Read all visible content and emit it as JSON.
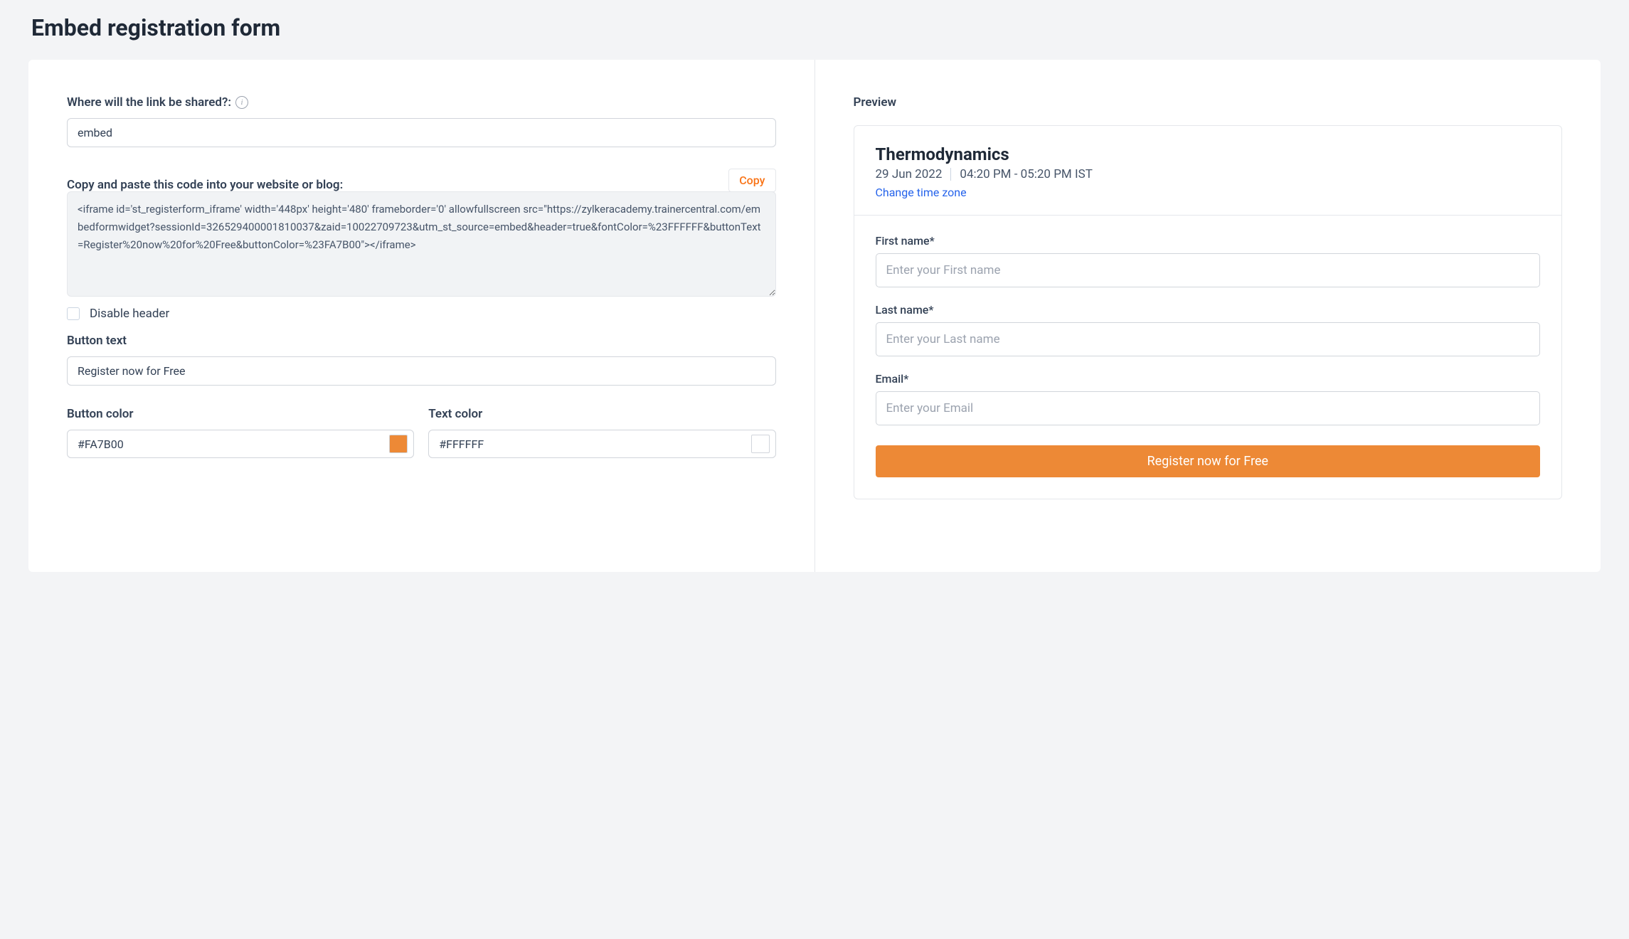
{
  "page_title": "Embed registration form",
  "left": {
    "share_label": "Where will the link be shared?:",
    "share_value": "embed",
    "code_label": "Copy and paste this code into your website or blog:",
    "copy_label": "Copy",
    "code_value": "<iframe id='st_registerform_iframe' width='448px' height='480' frameborder='0' allowfullscreen src=\"https://zylkeracademy.trainercentral.com/embedformwidget?sessionId=326529400001810037&zaid=10022709723&utm_st_source=embed&header=true&fontColor=%23FFFFFF&buttonText=Register%20now%20for%20Free&buttonColor=%23FA7B00\"></iframe>",
    "disable_header_label": "Disable header",
    "button_text_label": "Button text",
    "button_text_value": "Register now for Free",
    "button_color_label": "Button color",
    "button_color_value": "#FA7B00",
    "text_color_label": "Text color",
    "text_color_value": "#FFFFFF"
  },
  "preview": {
    "heading": "Preview",
    "course_title": "Thermodynamics",
    "date": "29 Jun 2022",
    "time": "04:20 PM - 05:20 PM IST",
    "change_tz": "Change time zone",
    "fields": {
      "first_name_label": "First name*",
      "first_name_placeholder": "Enter your First name",
      "last_name_label": "Last name*",
      "last_name_placeholder": "Enter your Last name",
      "email_label": "Email*",
      "email_placeholder": "Enter your Email"
    },
    "register_label": "Register now for Free"
  },
  "colors": {
    "button_swatch": "#ed8936",
    "text_swatch": "#ffffff"
  }
}
